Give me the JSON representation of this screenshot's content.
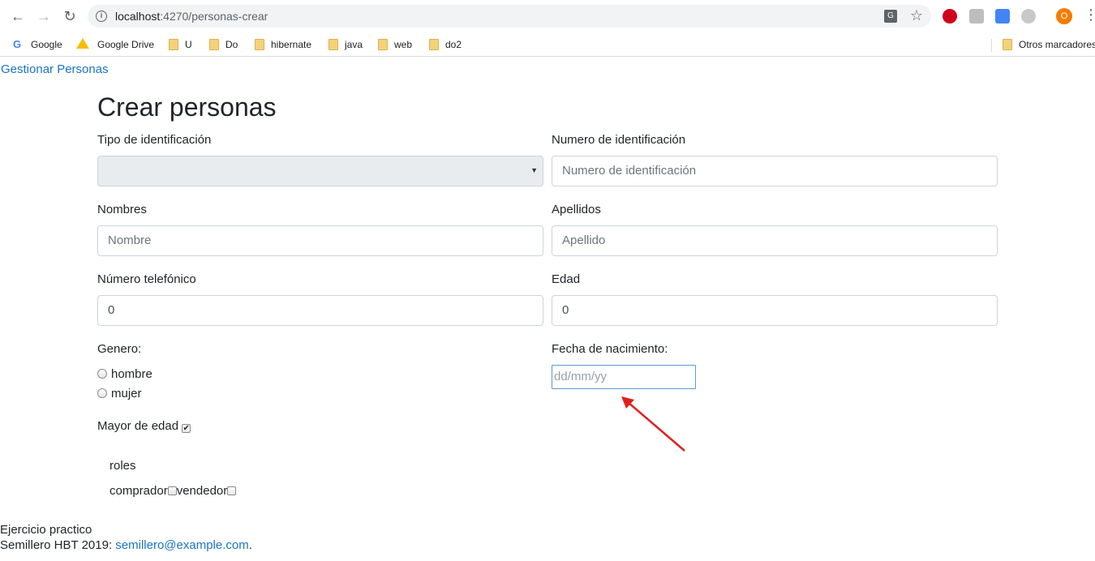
{
  "browser": {
    "url_host": "localhost",
    "url_rest": ":4270/personas-crear",
    "profile_initial": "O",
    "bookmarks": [
      "Google",
      "Google Drive",
      "U",
      "Do",
      "hibernate",
      "java",
      "web",
      "do2"
    ],
    "other_bookmarks": "Otros marcadores"
  },
  "nav": {
    "brand": "Gestionar Personas"
  },
  "form": {
    "title": "Crear personas",
    "tipo_label": "Tipo de identificación",
    "numero_label": "Numero de identificación",
    "numero_placeholder": "Numero de identificación",
    "nombres_label": "Nombres",
    "nombres_placeholder": "Nombre",
    "apellidos_label": "Apellidos",
    "apellidos_placeholder": "Apellido",
    "telefono_label": "Número telefónico",
    "telefono_value": "0",
    "edad_label": "Edad",
    "edad_value": "0",
    "genero_label": "Genero:",
    "genero_options": [
      "hombre",
      "mujer"
    ],
    "fecha_label": "Fecha de nacimiento:",
    "fecha_placeholder": "dd/mm/yy",
    "mayor_label": "Mayor de edad",
    "mayor_checked": true,
    "roles_label": "roles",
    "roles_options": [
      "comprador",
      "vendedor"
    ]
  },
  "footer": {
    "line1": "Ejercicio practico",
    "line2_prefix": "Semillero HBT 2019: ",
    "email": "semillero@example.com",
    "line2_suffix": "."
  },
  "colors": {
    "link": "#1a73c8",
    "arrow": "#e02020",
    "disabled_bg": "#e9ecef"
  }
}
